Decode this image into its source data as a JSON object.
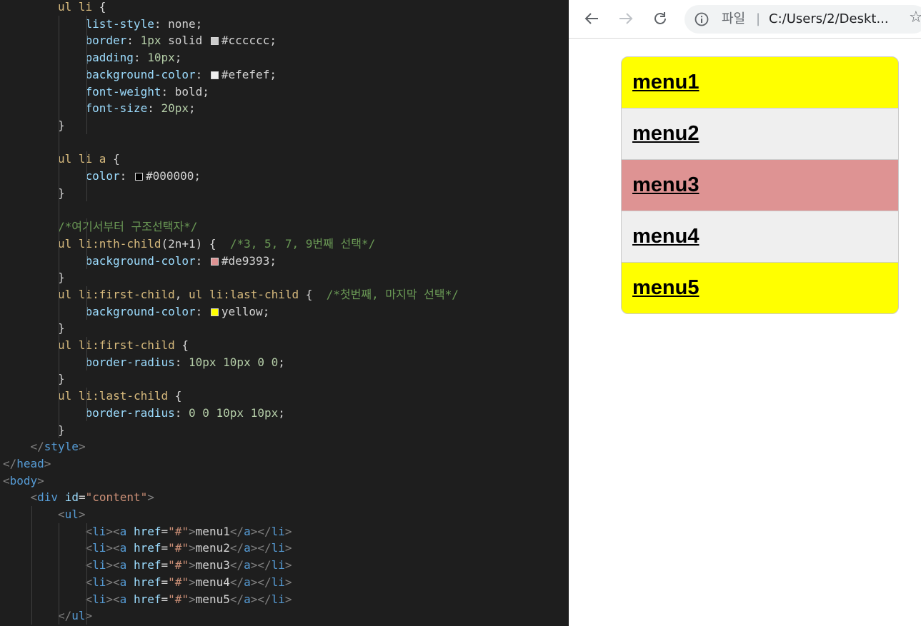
{
  "editor": {
    "lines": [
      {
        "indent": 2,
        "tokens": [
          [
            "k",
            "ul li"
          ],
          [
            "v",
            " {"
          ]
        ]
      },
      {
        "indent": 3,
        "tokens": [
          [
            "p",
            "list-style"
          ],
          [
            "v",
            ": none;"
          ]
        ]
      },
      {
        "indent": 3,
        "tokens": [
          [
            "p",
            "border"
          ],
          [
            "v",
            ": "
          ],
          [
            "n",
            "1px"
          ],
          [
            "v",
            " solid "
          ],
          [
            "sw",
            "#cccccc"
          ],
          [
            "v",
            "#cccccc;"
          ]
        ]
      },
      {
        "indent": 3,
        "tokens": [
          [
            "p",
            "padding"
          ],
          [
            "v",
            ": "
          ],
          [
            "n",
            "10px"
          ],
          [
            "v",
            ";"
          ]
        ]
      },
      {
        "indent": 3,
        "tokens": [
          [
            "p",
            "background-color"
          ],
          [
            "v",
            ": "
          ],
          [
            "sw",
            "#efefef"
          ],
          [
            "v",
            "#efefef;"
          ]
        ]
      },
      {
        "indent": 3,
        "tokens": [
          [
            "p",
            "font-weight"
          ],
          [
            "v",
            ": bold;"
          ]
        ]
      },
      {
        "indent": 3,
        "tokens": [
          [
            "p",
            "font-size"
          ],
          [
            "v",
            ": "
          ],
          [
            "n",
            "20px"
          ],
          [
            "v",
            ";"
          ]
        ]
      },
      {
        "indent": 2,
        "tokens": [
          [
            "v",
            "}"
          ]
        ]
      },
      {
        "indent": 2,
        "tokens": []
      },
      {
        "indent": 2,
        "tokens": [
          [
            "k",
            "ul li a"
          ],
          [
            "v",
            " {"
          ]
        ]
      },
      {
        "indent": 3,
        "tokens": [
          [
            "p",
            "color"
          ],
          [
            "v",
            ": "
          ],
          [
            "sw",
            "#000000"
          ],
          [
            "v",
            "#000000;"
          ]
        ]
      },
      {
        "indent": 2,
        "tokens": [
          [
            "v",
            "}"
          ]
        ]
      },
      {
        "indent": 2,
        "tokens": []
      },
      {
        "indent": 2,
        "tokens": [
          [
            "c",
            "/*여기서부터 구조선택자*/"
          ]
        ]
      },
      {
        "indent": 2,
        "tokens": [
          [
            "k",
            "ul li:nth-child"
          ],
          [
            "v",
            "(2n+1) {  "
          ],
          [
            "c",
            "/*3, 5, 7, 9번째 선택*/"
          ]
        ]
      },
      {
        "indent": 3,
        "tokens": [
          [
            "p",
            "background-color"
          ],
          [
            "v",
            ": "
          ],
          [
            "sw",
            "#de9393"
          ],
          [
            "v",
            "#de9393;"
          ]
        ]
      },
      {
        "indent": 2,
        "tokens": [
          [
            "v",
            "}"
          ]
        ]
      },
      {
        "indent": 2,
        "tokens": [
          [
            "k",
            "ul li:first-child"
          ],
          [
            "v",
            ", "
          ],
          [
            "k",
            "ul li:last-child"
          ],
          [
            "v",
            " {  "
          ],
          [
            "c",
            "/*첫번째, 마지막 선택*/"
          ]
        ]
      },
      {
        "indent": 3,
        "tokens": [
          [
            "p",
            "background-color"
          ],
          [
            "v",
            ": "
          ],
          [
            "sw",
            "yellow"
          ],
          [
            "v",
            "yellow;"
          ]
        ]
      },
      {
        "indent": 2,
        "tokens": [
          [
            "v",
            "}"
          ]
        ]
      },
      {
        "indent": 2,
        "tokens": [
          [
            "k",
            "ul li:first-child"
          ],
          [
            "v",
            " {"
          ]
        ]
      },
      {
        "indent": 3,
        "tokens": [
          [
            "p",
            "border-radius"
          ],
          [
            "v",
            ": "
          ],
          [
            "n",
            "10px 10px 0 0"
          ],
          [
            "v",
            ";"
          ]
        ]
      },
      {
        "indent": 2,
        "tokens": [
          [
            "v",
            "}"
          ]
        ]
      },
      {
        "indent": 2,
        "tokens": [
          [
            "k",
            "ul li:last-child"
          ],
          [
            "v",
            " {"
          ]
        ]
      },
      {
        "indent": 3,
        "tokens": [
          [
            "p",
            "border-radius"
          ],
          [
            "v",
            ": "
          ],
          [
            "n",
            "0 0 10px 10px"
          ],
          [
            "v",
            ";"
          ]
        ]
      },
      {
        "indent": 2,
        "tokens": [
          [
            "v",
            "}"
          ]
        ]
      },
      {
        "indent": 1,
        "tokens": [
          [
            "g",
            "</"
          ],
          [
            "t",
            "style"
          ],
          [
            "g",
            ">"
          ]
        ]
      },
      {
        "indent": 0,
        "tokens": [
          [
            "g",
            "</"
          ],
          [
            "t",
            "head"
          ],
          [
            "g",
            ">"
          ]
        ]
      },
      {
        "indent": 0,
        "tokens": [
          [
            "g",
            "<"
          ],
          [
            "t",
            "body"
          ],
          [
            "g",
            ">"
          ]
        ]
      },
      {
        "indent": 1,
        "tokens": [
          [
            "g",
            "<"
          ],
          [
            "t",
            "div"
          ],
          [
            "v",
            " "
          ],
          [
            "a",
            "id"
          ],
          [
            "v",
            "="
          ],
          [
            "s",
            "\"content\""
          ],
          [
            "g",
            ">"
          ]
        ]
      },
      {
        "indent": 2,
        "tokens": [
          [
            "g",
            "<"
          ],
          [
            "t",
            "ul"
          ],
          [
            "g",
            ">"
          ]
        ]
      },
      {
        "indent": 3,
        "tokens": [
          [
            "g",
            "<"
          ],
          [
            "t",
            "li"
          ],
          [
            "g",
            "><"
          ],
          [
            "t",
            "a"
          ],
          [
            "v",
            " "
          ],
          [
            "a",
            "href"
          ],
          [
            "v",
            "="
          ],
          [
            "s",
            "\"#\""
          ],
          [
            "g",
            ">"
          ],
          [
            "v",
            "menu1"
          ],
          [
            "g",
            "</"
          ],
          [
            "t",
            "a"
          ],
          [
            "g",
            "></"
          ],
          [
            "t",
            "li"
          ],
          [
            "g",
            ">"
          ]
        ]
      },
      {
        "indent": 3,
        "tokens": [
          [
            "g",
            "<"
          ],
          [
            "t",
            "li"
          ],
          [
            "g",
            "><"
          ],
          [
            "t",
            "a"
          ],
          [
            "v",
            " "
          ],
          [
            "a",
            "href"
          ],
          [
            "v",
            "="
          ],
          [
            "s",
            "\"#\""
          ],
          [
            "g",
            ">"
          ],
          [
            "v",
            "menu2"
          ],
          [
            "g",
            "</"
          ],
          [
            "t",
            "a"
          ],
          [
            "g",
            "></"
          ],
          [
            "t",
            "li"
          ],
          [
            "g",
            ">"
          ]
        ]
      },
      {
        "indent": 3,
        "tokens": [
          [
            "g",
            "<"
          ],
          [
            "t",
            "li"
          ],
          [
            "g",
            "><"
          ],
          [
            "t",
            "a"
          ],
          [
            "v",
            " "
          ],
          [
            "a",
            "href"
          ],
          [
            "v",
            "="
          ],
          [
            "s",
            "\"#\""
          ],
          [
            "g",
            ">"
          ],
          [
            "v",
            "menu3"
          ],
          [
            "g",
            "</"
          ],
          [
            "t",
            "a"
          ],
          [
            "g",
            "></"
          ],
          [
            "t",
            "li"
          ],
          [
            "g",
            ">"
          ]
        ]
      },
      {
        "indent": 3,
        "tokens": [
          [
            "g",
            "<"
          ],
          [
            "t",
            "li"
          ],
          [
            "g",
            "><"
          ],
          [
            "t",
            "a"
          ],
          [
            "v",
            " "
          ],
          [
            "a",
            "href"
          ],
          [
            "v",
            "="
          ],
          [
            "s",
            "\"#\""
          ],
          [
            "g",
            ">"
          ],
          [
            "v",
            "menu4"
          ],
          [
            "g",
            "</"
          ],
          [
            "t",
            "a"
          ],
          [
            "g",
            "></"
          ],
          [
            "t",
            "li"
          ],
          [
            "g",
            ">"
          ]
        ]
      },
      {
        "indent": 3,
        "tokens": [
          [
            "g",
            "<"
          ],
          [
            "t",
            "li"
          ],
          [
            "g",
            "><"
          ],
          [
            "t",
            "a"
          ],
          [
            "v",
            " "
          ],
          [
            "a",
            "href"
          ],
          [
            "v",
            "="
          ],
          [
            "s",
            "\"#\""
          ],
          [
            "g",
            ">"
          ],
          [
            "v",
            "menu5"
          ],
          [
            "g",
            "</"
          ],
          [
            "t",
            "a"
          ],
          [
            "g",
            "></"
          ],
          [
            "t",
            "li"
          ],
          [
            "g",
            ">"
          ]
        ]
      },
      {
        "indent": 2,
        "tokens": [
          [
            "g",
            "</"
          ],
          [
            "t",
            "ul"
          ],
          [
            "g",
            ">"
          ]
        ]
      }
    ]
  },
  "browser": {
    "scheme_label": "파일",
    "separator": "|",
    "url": "C:/Users/2/Deskt...",
    "menu_items": [
      {
        "label": "menu1",
        "bg": "#ffff00"
      },
      {
        "label": "menu2",
        "bg": "#efefef"
      },
      {
        "label": "menu3",
        "bg": "#de9393"
      },
      {
        "label": "menu4",
        "bg": "#efefef"
      },
      {
        "label": "menu5",
        "bg": "#ffff00"
      }
    ]
  }
}
